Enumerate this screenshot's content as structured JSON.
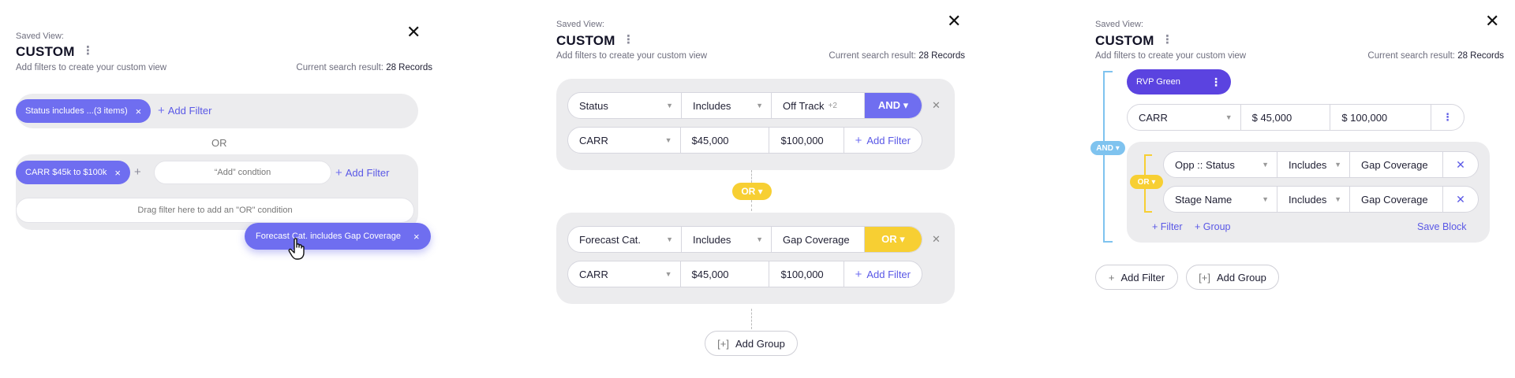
{
  "common": {
    "saved_view_label": "Saved View:",
    "view_title": "CUSTOM",
    "subtitle": "Add filters to create your custom view",
    "result_label": "Current search result:",
    "result_count": "28 Records",
    "close_icon": "close-icon",
    "kebab_icon": "kebab-icon"
  },
  "panel1": {
    "chip1": {
      "label": "Status includes ...(3 items)",
      "close": "×"
    },
    "add_filter": "Add Filter",
    "or_label": "OR",
    "chip2": {
      "label": "CARR $45k to $100k",
      "close": "×"
    },
    "add_condition_placeholder": "“Add” condtion",
    "drop_zone": "Drag filter here to add an \"OR\" condition",
    "dragging_chip": {
      "label": "Forecast Cat. includes Gap Coverage",
      "close": "×"
    }
  },
  "panel2": {
    "group1": {
      "row1": {
        "field": "Status",
        "operator": "Includes",
        "value": "Off Track",
        "extra": "+2",
        "logic": "AND ▾"
      },
      "row2": {
        "field": "CARR",
        "min": "$45,000",
        "max": "$100,000",
        "add_filter": "Add Filter"
      }
    },
    "connector": "OR ▾",
    "group2": {
      "row1": {
        "field": "Forecast Cat.",
        "operator": "Includes",
        "value": "Gap Coverage",
        "logic": "OR ▾"
      },
      "row2": {
        "field": "CARR",
        "min": "$45,000",
        "max": "$100,000",
        "add_filter": "Add Filter"
      }
    },
    "add_group": "Add Group",
    "add_group_icon": "[+]"
  },
  "panel3": {
    "saved_block_chip": "RVP Green",
    "and_pill": "AND ▾",
    "carr_row": {
      "field": "CARR",
      "min": "$ 45,000",
      "max": "$ 100,000"
    },
    "or_pill": "OR ▾",
    "nested": {
      "row1": {
        "field": "Opp :: Status",
        "operator": "Includes",
        "value": "Gap Coverage"
      },
      "row2": {
        "field": "Stage Name",
        "operator": "Includes",
        "value": "Gap Coverage"
      },
      "filter_link": "+ Filter",
      "group_link": "+ Group",
      "save_block": "Save Block"
    },
    "add_filter": "Add Filter",
    "add_group": "Add Group",
    "add_group_icon": "[+]"
  },
  "colors": {
    "primary": "#6f6ef0",
    "or_yellow": "#f7cf33",
    "and_blue": "#7fc3ef",
    "grey_bg": "#ececee"
  }
}
